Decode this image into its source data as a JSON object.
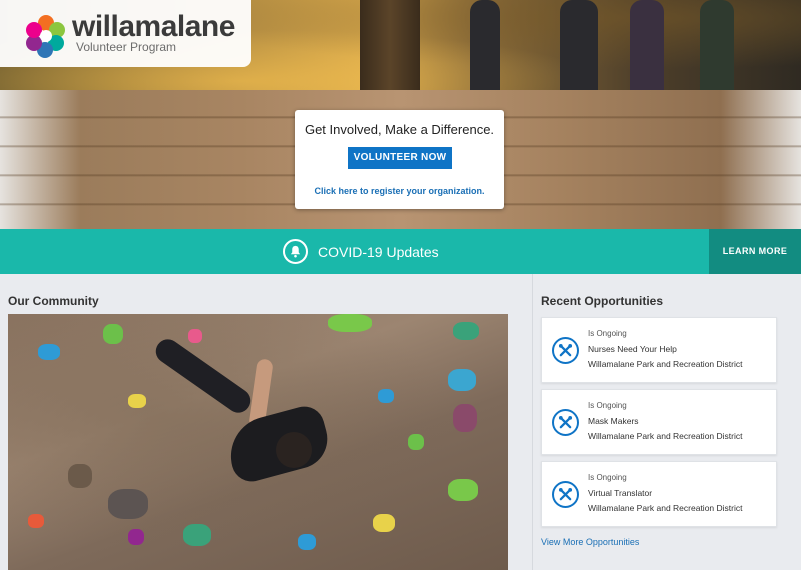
{
  "brand": {
    "name": "willamalane",
    "subtitle": "Volunteer Program"
  },
  "cta": {
    "title": "Get Involved, Make a Difference.",
    "button_label": "VOLUNTEER NOW",
    "register_link": "Click here to register your organization."
  },
  "covid": {
    "text": "COVID-19 Updates",
    "learn_more": "LEARN MORE",
    "icon": "bell-icon"
  },
  "community": {
    "title": "Our Community"
  },
  "recent": {
    "title": "Recent Opportunities",
    "items": [
      {
        "status": "Is Ongoing",
        "name": "Nurses Need Your Help",
        "org": "Willamalane Park and Recreation District",
        "icon": "tools-icon"
      },
      {
        "status": "Is Ongoing",
        "name": "Mask Makers",
        "org": "Willamalane Park and Recreation District",
        "icon": "tools-icon"
      },
      {
        "status": "Is Ongoing",
        "name": "Virtual Translator",
        "org": "Willamalane Park and Recreation District",
        "icon": "tools-icon"
      }
    ],
    "view_more": "View More Opportunities"
  },
  "colors": {
    "accent_blue": "#0f74c6",
    "teal_bar": "#1ab8aa",
    "teal_dark": "#128c81"
  }
}
